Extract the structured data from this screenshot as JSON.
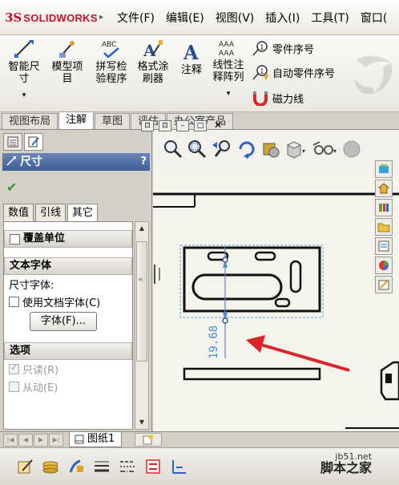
{
  "app": {
    "logo_ds": "3S",
    "logo_text": "SOLIDWORKS"
  },
  "menu": [
    "文件(F)",
    "编辑(E)",
    "视图(V)",
    "插入(I)",
    "工具(T)",
    "窗口("
  ],
  "ribbon": {
    "smart_dim_l1": "智能尺",
    "smart_dim_l2": "寸",
    "model_items_l1": "模型项",
    "model_items_l2": "目",
    "spell_icon_text": "ABC",
    "spell_l1": "拼写检",
    "spell_l2": "验程序",
    "format_l1": "格式涂",
    "format_l2": "刷器",
    "note": "注释",
    "linear_note_l1": "线性注",
    "linear_note_l2": "释阵列",
    "linear_icon_text": "AAA",
    "balloon": "零件序号",
    "auto_balloon": "自动零件序号",
    "magnetic_line": "磁力线"
  },
  "tabs": [
    "视图布局",
    "注解",
    "草图",
    "评估",
    "办公室产品"
  ],
  "active_tab": 1,
  "panel": {
    "title": "尺寸",
    "help": "?",
    "sub_tabs": [
      "数值",
      "引线",
      "其它"
    ],
    "active_sub_tab": 2,
    "override_units": "覆盖单位",
    "text_font_header": "文本字体",
    "dim_font_label": "尺寸字体:",
    "use_doc_font": "使用文档字体(C)",
    "font_button": "字体(F)...",
    "options_header": "选项",
    "read_only": "只读(R)",
    "driven": "从动(E)"
  },
  "sheet": {
    "name": "图纸1"
  },
  "drawing": {
    "dimension_value": "19.68"
  },
  "colors": {
    "accent": "#3e5d95",
    "dimension": "#4a8fd4",
    "arrow": "#d9262a"
  },
  "watermark": {
    "line1": "jb51.net",
    "line2": "脚本之家"
  }
}
